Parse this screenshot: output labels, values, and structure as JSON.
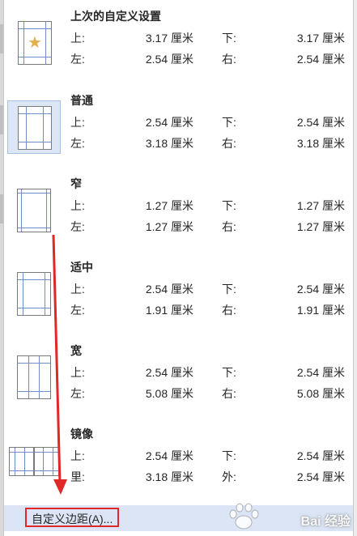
{
  "presets": [
    {
      "name": "上次的自定义设置",
      "thumbnail_icon": "star-icon",
      "selected": false,
      "rows": [
        {
          "label_a": "上:",
          "value_a": "3.17 厘米",
          "label_b": "下:",
          "value_b": "3.17 厘米"
        },
        {
          "label_a": "左:",
          "value_a": "2.54 厘米",
          "label_b": "右:",
          "value_b": "2.54 厘米"
        }
      ]
    },
    {
      "name": "普通",
      "selected": true,
      "rows": [
        {
          "label_a": "上:",
          "value_a": "2.54 厘米",
          "label_b": "下:",
          "value_b": "2.54 厘米"
        },
        {
          "label_a": "左:",
          "value_a": "3.18 厘米",
          "label_b": "右:",
          "value_b": "3.18 厘米"
        }
      ]
    },
    {
      "name": "窄",
      "selected": false,
      "rows": [
        {
          "label_a": "上:",
          "value_a": "1.27 厘米",
          "label_b": "下:",
          "value_b": "1.27 厘米"
        },
        {
          "label_a": "左:",
          "value_a": "1.27 厘米",
          "label_b": "右:",
          "value_b": "1.27 厘米"
        }
      ]
    },
    {
      "name": "适中",
      "selected": false,
      "rows": [
        {
          "label_a": "上:",
          "value_a": "2.54 厘米",
          "label_b": "下:",
          "value_b": "2.54 厘米"
        },
        {
          "label_a": "左:",
          "value_a": "1.91 厘米",
          "label_b": "右:",
          "value_b": "1.91 厘米"
        }
      ]
    },
    {
      "name": "宽",
      "selected": false,
      "rows": [
        {
          "label_a": "上:",
          "value_a": "2.54 厘米",
          "label_b": "下:",
          "value_b": "2.54 厘米"
        },
        {
          "label_a": "左:",
          "value_a": "5.08 厘米",
          "label_b": "右:",
          "value_b": "5.08 厘米"
        }
      ]
    },
    {
      "name": "镜像",
      "selected": false,
      "rows": [
        {
          "label_a": "上:",
          "value_a": "2.54 厘米",
          "label_b": "下:",
          "value_b": "2.54 厘米"
        },
        {
          "label_a": "里:",
          "value_a": "3.18 厘米",
          "label_b": "外:",
          "value_b": "2.54 厘米"
        }
      ]
    }
  ],
  "footer": {
    "custom_margins_label": "自定义边距(A)..."
  },
  "annotation": {
    "highlight_color": "#e02828"
  },
  "watermark": {
    "text": "Bai 经验"
  },
  "colors": {
    "selected_bg": "#dce6f4",
    "margin_line": "#6f8fc6",
    "footer_bg": "#dbe5f5"
  }
}
